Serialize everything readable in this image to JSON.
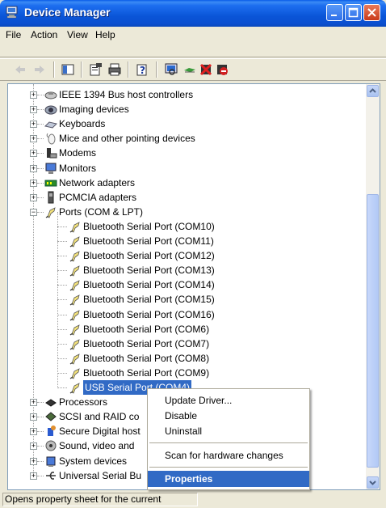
{
  "window": {
    "title": "Device Manager"
  },
  "menubar": {
    "items": [
      "File",
      "Action",
      "View",
      "Help"
    ]
  },
  "tree": {
    "items": [
      {
        "label": "IEEE 1394 Bus host controllers",
        "icon": "ieee1394-icon"
      },
      {
        "label": "Imaging devices",
        "icon": "camera-icon"
      },
      {
        "label": "Keyboards",
        "icon": "keyboard-icon"
      },
      {
        "label": "Mice and other pointing devices",
        "icon": "mouse-icon"
      },
      {
        "label": "Modems",
        "icon": "modem-icon"
      },
      {
        "label": "Monitors",
        "icon": "monitor-icon"
      },
      {
        "label": "Network adapters",
        "icon": "network-adapter-icon"
      },
      {
        "label": "PCMCIA adapters",
        "icon": "pcmcia-icon"
      },
      {
        "label": "Ports (COM & LPT)",
        "icon": "port-icon"
      },
      {
        "label": "Bluetooth Serial Port (COM10)",
        "icon": "port-icon"
      },
      {
        "label": "Bluetooth Serial Port (COM11)",
        "icon": "port-icon"
      },
      {
        "label": "Bluetooth Serial Port (COM12)",
        "icon": "port-icon"
      },
      {
        "label": "Bluetooth Serial Port (COM13)",
        "icon": "port-icon"
      },
      {
        "label": "Bluetooth Serial Port (COM14)",
        "icon": "port-icon"
      },
      {
        "label": "Bluetooth Serial Port (COM15)",
        "icon": "port-icon"
      },
      {
        "label": "Bluetooth Serial Port (COM16)",
        "icon": "port-icon"
      },
      {
        "label": "Bluetooth Serial Port (COM6)",
        "icon": "port-icon"
      },
      {
        "label": "Bluetooth Serial Port (COM7)",
        "icon": "port-icon"
      },
      {
        "label": "Bluetooth Serial Port (COM8)",
        "icon": "port-icon"
      },
      {
        "label": "Bluetooth Serial Port (COM9)",
        "icon": "port-icon"
      },
      {
        "label": "USB Serial Port (COM4)",
        "icon": "port-icon"
      },
      {
        "label": "Processors",
        "icon": "processor-icon"
      },
      {
        "label": "SCSI and RAID co",
        "icon": "scsi-icon"
      },
      {
        "label": "Secure Digital host",
        "icon": "sd-host-icon"
      },
      {
        "label": "Sound, video and",
        "icon": "sound-icon"
      },
      {
        "label": "System devices",
        "icon": "system-devices-icon"
      },
      {
        "label": "Universal Serial Bu",
        "icon": "usb-icon"
      }
    ]
  },
  "context_menu": {
    "items": [
      "Update Driver...",
      "Disable",
      "Uninstall",
      "Scan for hardware changes",
      "Properties"
    ]
  },
  "status": {
    "text": "Opens property sheet for the current"
  },
  "colors": {
    "titlebar": "#0a55d8",
    "selection": "#316ac5",
    "window_bg": "#ece9d8"
  }
}
